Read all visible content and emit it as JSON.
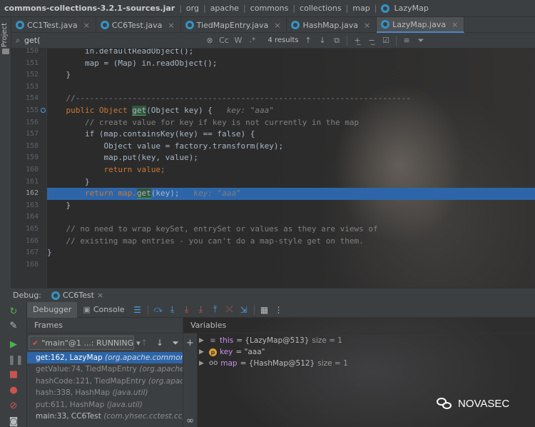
{
  "breadcrumb": {
    "jar": "commons-collections-3.2.1-sources.jar",
    "parts": [
      "org",
      "apache",
      "commons",
      "collections",
      "map"
    ],
    "file": "LazyMap"
  },
  "project_strip": {
    "label": "Project"
  },
  "tabs": [
    {
      "label": "CC1Test.java",
      "active": false
    },
    {
      "label": "CC6Test.java",
      "active": false
    },
    {
      "label": "TiedMapEntry.java",
      "active": false
    },
    {
      "label": "HashMap.java",
      "active": false
    },
    {
      "label": "LazyMap.java",
      "active": true
    }
  ],
  "search": {
    "query": "get(",
    "match_case": "Cc",
    "words": "W",
    "regex": ".*",
    "results": "4 results"
  },
  "editor": {
    "lines": [
      {
        "num": "150",
        "code": "        in.defaultReadObject();"
      },
      {
        "num": "151",
        "code": "        map = (Map) in.readObject();"
      },
      {
        "num": "152",
        "code": "    }"
      },
      {
        "num": "153",
        "code": ""
      },
      {
        "num": "154",
        "code": "    //-----------------------------------------------------------------------"
      },
      {
        "num": "155",
        "pre": "    public Object ",
        "match": "get",
        "post": "(Object key) {",
        "hint": "key: \"aaa\""
      },
      {
        "num": "156",
        "code": "        // create value for key if key is not currently in the map"
      },
      {
        "num": "157",
        "code": "        if (map.containsKey(key) == false) {"
      },
      {
        "num": "158",
        "code": "            Object value = factory.transform(key);"
      },
      {
        "num": "159",
        "code": "            map.put(key, value);"
      },
      {
        "num": "160",
        "code": "            return value;"
      },
      {
        "num": "161",
        "code": "        }"
      },
      {
        "num": "162",
        "pre": "        return map.",
        "match": "get",
        "post": "(key);",
        "hint": "key: \"aaa\""
      },
      {
        "num": "163",
        "code": "    }"
      },
      {
        "num": "164",
        "code": ""
      },
      {
        "num": "165",
        "code": "    // no need to wrap keySet, entrySet or values as they are views of"
      },
      {
        "num": "166",
        "code": "    // existing map entries - you can't do a map-style get on them."
      },
      {
        "num": "167",
        "code": "}"
      },
      {
        "num": "168",
        "code": ""
      }
    ]
  },
  "debug": {
    "title": "Debug:",
    "session": "CC6Test",
    "tabs": {
      "debugger": "Debugger",
      "console": "Console"
    },
    "frames_header": "Frames",
    "thread": "\"main\"@1 ...: RUNNING",
    "frames": [
      {
        "method": "get:162, LazyMap",
        "cls": "(org.apache.commons.collections.map)",
        "selected": true
      },
      {
        "method": "getValue:74, TiedMapEntry",
        "cls": "(org.apache.commons.collections.keyvalue)",
        "selected": false
      },
      {
        "method": "hashCode:121, TiedMapEntry",
        "cls": "(org.apache.commons.collections.keyvalue)",
        "selected": false
      },
      {
        "method": "hash:338, HashMap",
        "cls": "(java.util)",
        "selected": false
      },
      {
        "method": "put:611, HashMap",
        "cls": "(java.util)",
        "selected": false
      },
      {
        "method": "main:33, CC6Test",
        "cls": "(com.yhsec.cctest.cc)",
        "selected": false
      }
    ],
    "variables_header": "Variables",
    "variables": [
      {
        "name": "this",
        "value": "= {LazyMap@513}",
        "extra": "size = 1",
        "icon": "this"
      },
      {
        "name": "key",
        "value": "= \"aaa\"",
        "extra": "",
        "icon": "p"
      },
      {
        "name": "map",
        "value": "= {HashMap@512}",
        "extra": "size = 1",
        "icon": "oo"
      }
    ]
  },
  "watermark": {
    "text": "NOVASEC"
  },
  "colors": {
    "accent": "#2d65a8",
    "keyword": "#cc7832",
    "field": "#9876aa",
    "comment": "#808080"
  }
}
